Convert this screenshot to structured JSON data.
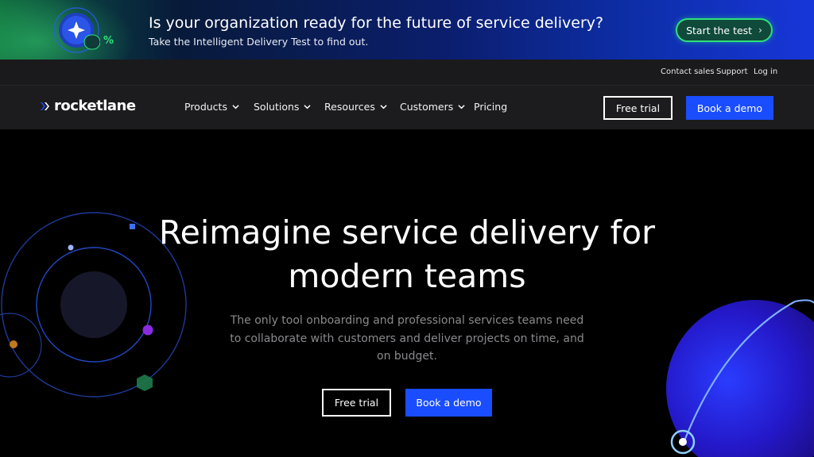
{
  "promo": {
    "badge_text": "%",
    "title": "Is your organization ready for the future of service delivery?",
    "subtitle": "Take the Intelligent Delivery Test to find out.",
    "cta_label": "Start the test",
    "cta_icon": "chevron-right-icon"
  },
  "utility": {
    "links": [
      "Contact sales",
      "Support",
      "Log in"
    ]
  },
  "nav": {
    "logo_text": "rocketlane",
    "items": [
      {
        "label": "Products",
        "has_dropdown": true
      },
      {
        "label": "Solutions",
        "has_dropdown": true
      },
      {
        "label": "Resources",
        "has_dropdown": true
      },
      {
        "label": "Customers",
        "has_dropdown": true
      },
      {
        "label": "Pricing",
        "has_dropdown": false
      }
    ],
    "free_trial_label": "Free trial",
    "book_demo_label": "Book a demo"
  },
  "hero": {
    "title_line1": "Reimagine service delivery for",
    "title_line2": "modern teams",
    "subtitle": "The only tool onboarding and professional services teams need to collaborate with customers and deliver projects on time, and on budget.",
    "free_trial_label": "Free trial",
    "book_demo_label": "Book a demo"
  },
  "colors": {
    "accent_blue": "#1a4dff",
    "promo_green": "#2ee07a",
    "background": "#000000",
    "nav_background": "#1c1c1e"
  }
}
